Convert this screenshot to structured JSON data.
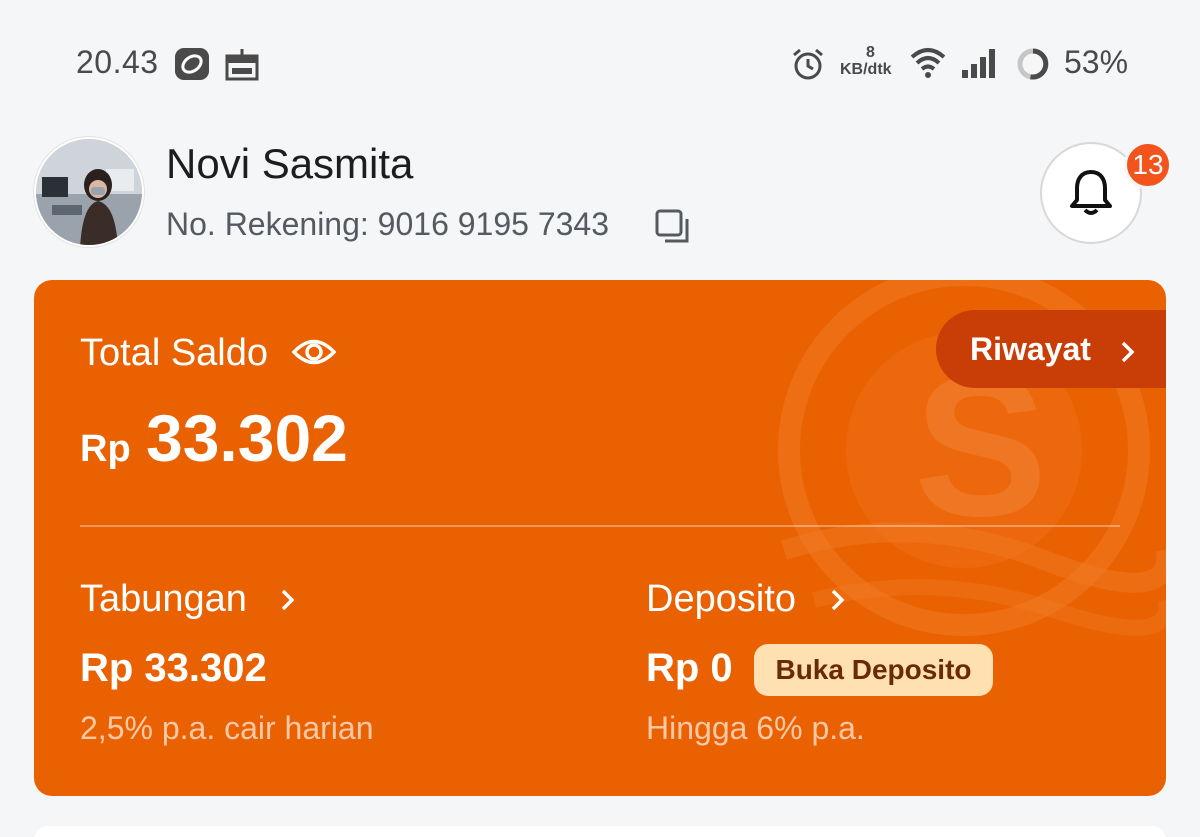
{
  "status_bar": {
    "time": "20.43",
    "net_speed_value": "8",
    "net_speed_unit": "KB/dtk",
    "battery": "53%",
    "icons": [
      "app-icon",
      "gift-icon",
      "alarm-icon",
      "wifi-icon",
      "signal-icon",
      "battery-icon"
    ]
  },
  "profile": {
    "name": "Novi Sasmita",
    "account_label": "No. Rekening: 9016 9195 7343",
    "notification_count": "13"
  },
  "balance_card": {
    "total_label": "Total Saldo",
    "history_label": "Riwayat",
    "currency": "Rp",
    "total_amount": "33.302",
    "savings": {
      "label": "Tabungan",
      "amount": "Rp 33.302",
      "note": "2,5% p.a. cair harian"
    },
    "deposit": {
      "label": "Deposito",
      "amount": "Rp 0",
      "button": "Buka Deposito",
      "note": "Hingga 6% p.a."
    }
  },
  "colors": {
    "card": "#ea6101",
    "history_button": "#c93d06",
    "badge": "#f2541b",
    "deposit_button": "#ffe0b0"
  }
}
